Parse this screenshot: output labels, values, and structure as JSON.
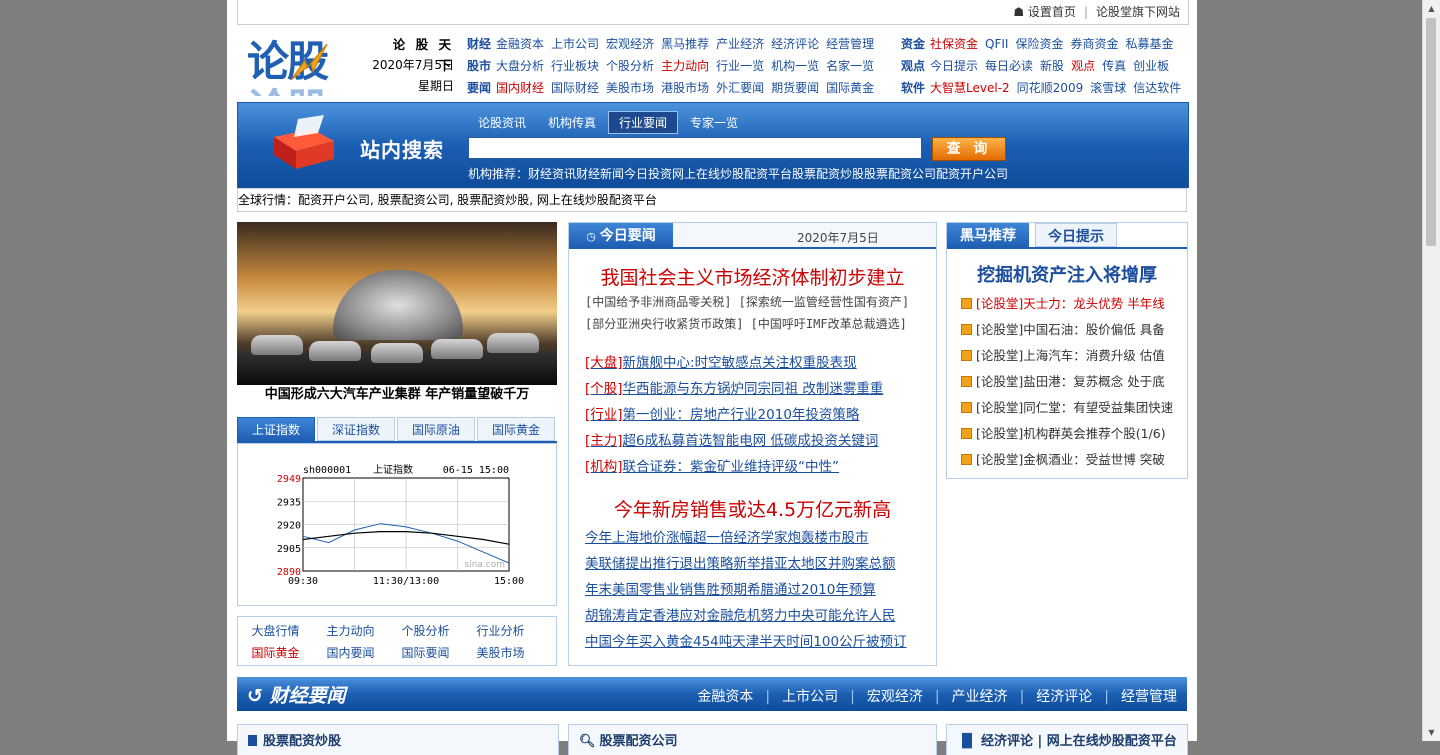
{
  "topbar": {
    "set_home": "设置首页",
    "sites": "论股堂旗下网站"
  },
  "logo": {
    "text": "论股"
  },
  "datebox": {
    "name": "论 股 天 下",
    "date": "2020年7月5日",
    "weekday": "星期日"
  },
  "nav_left": [
    {
      "head": "财经",
      "items": [
        {
          "t": "金融资本"
        },
        {
          "t": "上市公司"
        },
        {
          "t": "宏观经济"
        },
        {
          "t": "黑马推荐"
        },
        {
          "t": "产业经济"
        },
        {
          "t": "经济评论"
        },
        {
          "t": "经营管理"
        }
      ]
    },
    {
      "head": "股市",
      "items": [
        {
          "t": "大盘分析"
        },
        {
          "t": "行业板块"
        },
        {
          "t": "个股分析"
        },
        {
          "t": "主力动向",
          "red": true
        },
        {
          "t": "行业一览"
        },
        {
          "t": "机构一览"
        },
        {
          "t": "名家一览"
        }
      ]
    },
    {
      "head": "要闻",
      "items": [
        {
          "t": "国内财经",
          "red": true
        },
        {
          "t": "国际财经"
        },
        {
          "t": "美股市场"
        },
        {
          "t": "港股市场"
        },
        {
          "t": "外汇要闻"
        },
        {
          "t": "期货要闻"
        },
        {
          "t": "国际黄金"
        }
      ]
    }
  ],
  "nav_right": [
    {
      "head": "资金",
      "items": [
        {
          "t": "社保资金",
          "red": true
        },
        {
          "t": "QFII"
        },
        {
          "t": "保险资金"
        },
        {
          "t": "券商资金"
        },
        {
          "t": "私募基金"
        }
      ]
    },
    {
      "head": "观点",
      "items": [
        {
          "t": "今日提示"
        },
        {
          "t": "每日必读"
        },
        {
          "t": "新股"
        },
        {
          "t": "观点",
          "red": true
        },
        {
          "t": "传真"
        },
        {
          "t": "创业板"
        }
      ]
    },
    {
      "head": "软件",
      "items": [
        {
          "t": "大智慧Level-2",
          "red": true
        },
        {
          "t": "同花顺2009"
        },
        {
          "t": "滚雪球"
        },
        {
          "t": "信达软件"
        }
      ]
    }
  ],
  "search": {
    "title": "站内搜索",
    "tabs": [
      "论股资讯",
      "机构传真",
      "行业要闻",
      "专家一览"
    ],
    "active_tab": 2,
    "query": "",
    "button": "查 询",
    "recommend": "机构推荐：财经资讯财经新闻今日投资网上在线炒股配资平台股票配资炒股股票配资公司配资开户公司"
  },
  "ticker": "全球行情：配资开户公司, 股票配资公司, 股票配资炒股, 网上在线炒股配资平台",
  "photo": {
    "caption": "中国形成六大汽车产业集群 年产销量望破千万"
  },
  "index_tabs": [
    "上证指数",
    "深证指数",
    "国际原油",
    "国际黄金"
  ],
  "index_chart": {
    "code": "sh000001",
    "name": "上证指数",
    "time": "06-15 15:00",
    "watermark": "sina.com",
    "y_ticks": [
      "2949",
      "2935",
      "2920",
      "2905",
      "2890"
    ],
    "x_ticks": [
      "09:30",
      "11:30/13:00",
      "15:00"
    ]
  },
  "chart_data": {
    "type": "line",
    "title": "上证指数",
    "x": [
      "09:30",
      "10:00",
      "10:30",
      "11:00",
      "11:30/13:00",
      "13:30",
      "14:00",
      "14:30",
      "15:00"
    ],
    "series": [
      {
        "values": [
          2912,
          2908,
          2916,
          2920,
          2918,
          2914,
          2909,
          2902,
          2895
        ]
      },
      {
        "values": [
          2910,
          2912,
          2914,
          2915,
          2915,
          2914,
          2912,
          2910,
          2907
        ]
      }
    ],
    "ylim": [
      2890,
      2949
    ]
  },
  "links2": [
    [
      {
        "t": "大盘行情"
      },
      {
        "t": "主力动向"
      },
      {
        "t": "个股分析"
      },
      {
        "t": "行业分析"
      }
    ],
    [
      {
        "t": "国际黄金",
        "red": true
      },
      {
        "t": "国内要闻"
      },
      {
        "t": "国际要闻"
      },
      {
        "t": "美股市场"
      }
    ]
  ],
  "news": {
    "tab": "今日要闻",
    "date": "2020年7月5日",
    "headline1": "我国社会主义市场经济体制初步建立",
    "sub1": "[中国给予非洲商品零关税] [探索统一监管经营性国有资产]",
    "sub2": "[部分亚洲央行收紧货币政策] [中国呼吁IMF改革总裁遴选]",
    "items": [
      {
        "tag": "[大盘]",
        "text": "新旗舰中心:时空敏感点关注权重股表现"
      },
      {
        "tag": "[个股]",
        "text": "华西能源与东方锅炉同宗同祖 改制迷雾重重"
      },
      {
        "tag": "[行业]",
        "text": "第一创业：房地产行业2010年投资策略"
      },
      {
        "tag": "[主力]",
        "text": "超6成私募首选智能电网 低碳成投资关键词"
      },
      {
        "tag": "[机构]",
        "text": "联合证券：紫金矿业维持评级“中性”"
      }
    ],
    "headline2": "今年新房销售或达4.5万亿元新高",
    "items2": [
      "今年上海地价涨幅超一倍经济学家炮轰楼市股市",
      "美联储提出推行退出策略新举措亚太地区并购案总额",
      "年末美国零售业销售胜预期希腊通过2010年预算",
      "胡锦涛肯定香港应对金融危机努力中央可能允许人民",
      "中国今年买入黄金454吨天津半天时间100公斤被预订"
    ]
  },
  "dark": {
    "tabs": [
      "黑马推荐",
      "今日提示"
    ],
    "headline": "挖掘机资产注入将增厚",
    "items": [
      "[论股堂]天士力：龙头优势 半年线",
      "[论股堂]中国石油：股价偏低 具备",
      "[论股堂]上海汽车：消费升级 估值",
      "[论股堂]盐田港：复苏概念 处于底",
      "[论股堂]同仁堂：有望受益集团快速",
      "[论股堂]机构群英会推荐个股(1/6)",
      "[论股堂]金枫酒业：受益世博 突破"
    ]
  },
  "section": {
    "title": "财经要闻",
    "links": [
      "金融资本",
      "上市公司",
      "宏观经济",
      "产业经济",
      "经济评论",
      "经营管理"
    ]
  },
  "panels": [
    "股票配资炒股",
    "股票配资公司",
    "经济评论 | 网上在线炒股配资平台"
  ]
}
